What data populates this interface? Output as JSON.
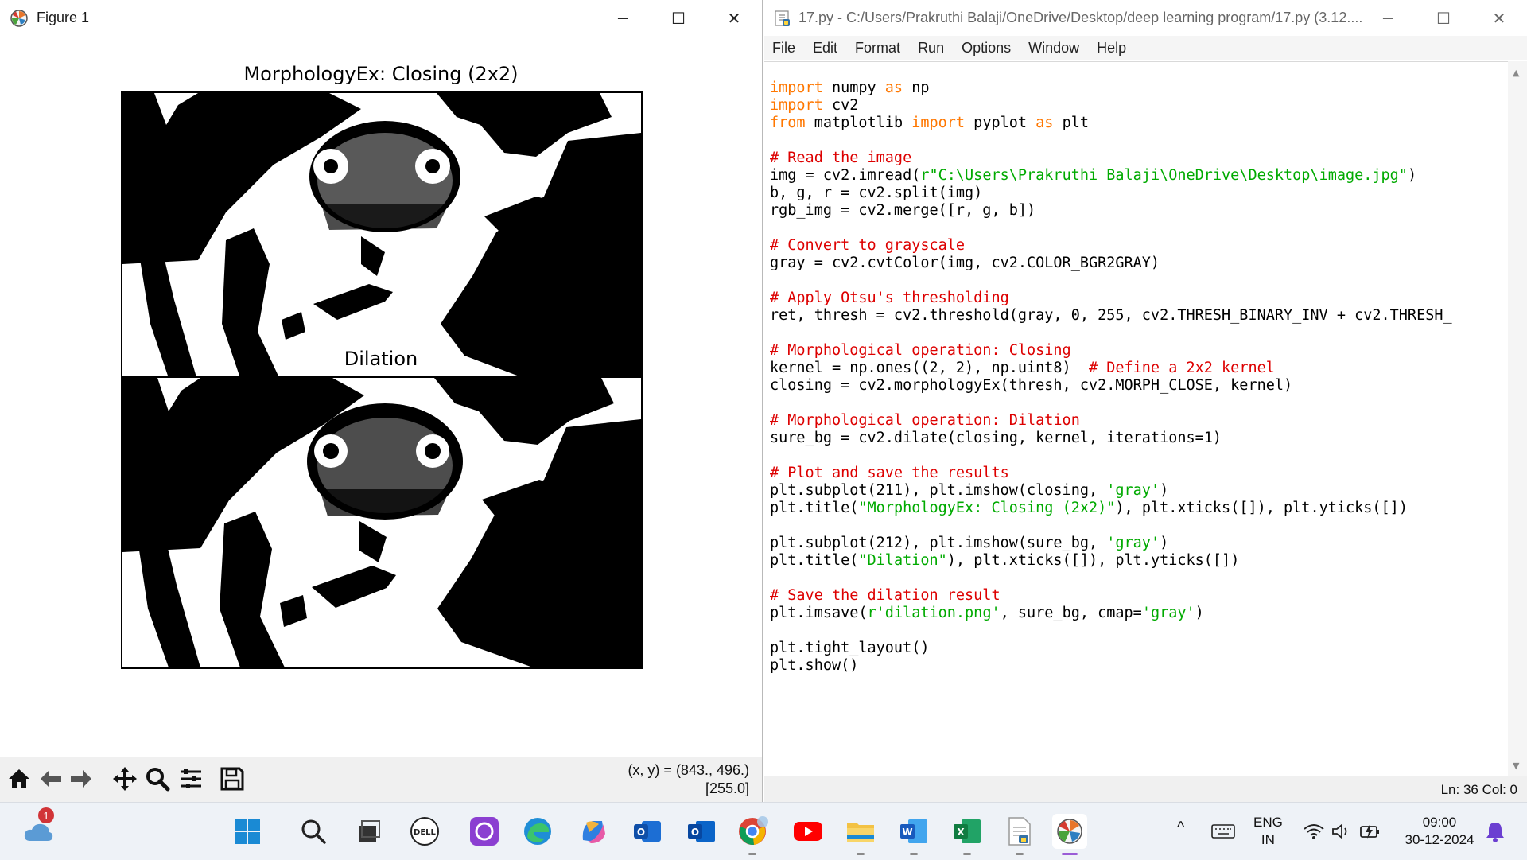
{
  "figure_window": {
    "title": "Figure 1",
    "controls": {
      "minimize": "─",
      "maximize": "☐",
      "close": "✕"
    },
    "subplots": [
      {
        "title": "MorphologyEx: Closing (2x2)"
      },
      {
        "title": "Dilation"
      }
    ],
    "toolbar": {
      "buttons": [
        "home-icon",
        "back-arrow-icon",
        "forward-arrow-icon",
        "pan-icon",
        "zoom-icon",
        "configure-subplots-icon",
        "save-icon"
      ],
      "coord_line1": "(x, y) = (843., 496.)",
      "coord_line2": "[255.0]"
    }
  },
  "idle_window": {
    "title": "17.py - C:/Users/Prakruthi Balaji/OneDrive/Desktop/deep learning program/17.py (3.12....",
    "controls": {
      "minimize": "─",
      "maximize": "☐",
      "close": "✕"
    },
    "menu": [
      "File",
      "Edit",
      "Format",
      "Run",
      "Options",
      "Window",
      "Help"
    ],
    "status": "Ln: 36  Col: 0",
    "code": {
      "l1_kw": "import",
      "l1_a": " numpy ",
      "l1_kw2": "as",
      "l1_b": " np",
      "l2_kw": "import",
      "l2_a": " cv2",
      "l3_kw": "from",
      "l3_a": " matplotlib ",
      "l3_kw2": "import",
      "l3_b": " pyplot ",
      "l3_kw3": "as",
      "l3_c": " plt",
      "l5_cm": "# Read the image",
      "l6_a": "img = cv2.imread(",
      "l6_st": "r\"C:\\Users\\Prakruthi Balaji\\OneDrive\\Desktop\\image.jpg\"",
      "l6_b": ")",
      "l7": "b, g, r = cv2.split(img)",
      "l8": "rgb_img = cv2.merge([r, g, b])",
      "l10_cm": "# Convert to grayscale",
      "l11": "gray = cv2.cvtColor(img, cv2.COLOR_BGR2GRAY)",
      "l13_cm": "# Apply Otsu's thresholding",
      "l14": "ret, thresh = cv2.threshold(gray, 0, 255, cv2.THRESH_BINARY_INV + cv2.THRESH_",
      "l16_cm": "# Morphological operation: Closing",
      "l17_a": "kernel = np.ones((2, 2), np.uint8)  ",
      "l17_cm": "# Define a 2x2 kernel",
      "l18": "closing = cv2.morphologyEx(thresh, cv2.MORPH_CLOSE, kernel)",
      "l20_cm": "# Morphological operation: Dilation",
      "l21": "sure_bg = cv2.dilate(closing, kernel, iterations=1)",
      "l23_cm": "# Plot and save the results",
      "l24_a": "plt.subplot(211), plt.imshow(closing, ",
      "l24_st": "'gray'",
      "l24_b": ")",
      "l25_a": "plt.title(",
      "l25_st": "\"MorphologyEx: Closing (2x2)\"",
      "l25_b": "), plt.xticks([]), plt.yticks([])",
      "l27_a": "plt.subplot(212), plt.imshow(sure_bg, ",
      "l27_st": "'gray'",
      "l27_b": ")",
      "l28_a": "plt.title(",
      "l28_st": "\"Dilation\"",
      "l28_b": "), plt.xticks([]), plt.yticks([])",
      "l30_cm": "# Save the dilation result",
      "l31_a": "plt.imsave(",
      "l31_st": "r'dilation.png'",
      "l31_b": ", sure_bg, cmap=",
      "l31_st2": "'gray'",
      "l31_c": ")",
      "l33": "plt.tight_layout()",
      "l34": "plt.show()"
    }
  },
  "taskbar": {
    "weather_badge": "1",
    "apps": [
      "windows-start-icon",
      "search-icon",
      "task-view-icon",
      "dell-icon",
      "cortana-icon",
      "edge-icon",
      "copilot-icon",
      "outlook-new-icon",
      "outlook-icon",
      "chrome-icon",
      "youtube-icon",
      "file-explorer-icon",
      "word-icon",
      "excel-icon",
      "idle-file-icon",
      "matplotlib-figure-icon"
    ],
    "tray": {
      "chevron": "^",
      "lang_line1": "ENG",
      "lang_line2": "IN",
      "time": "09:00",
      "date": "30-12-2024"
    }
  }
}
